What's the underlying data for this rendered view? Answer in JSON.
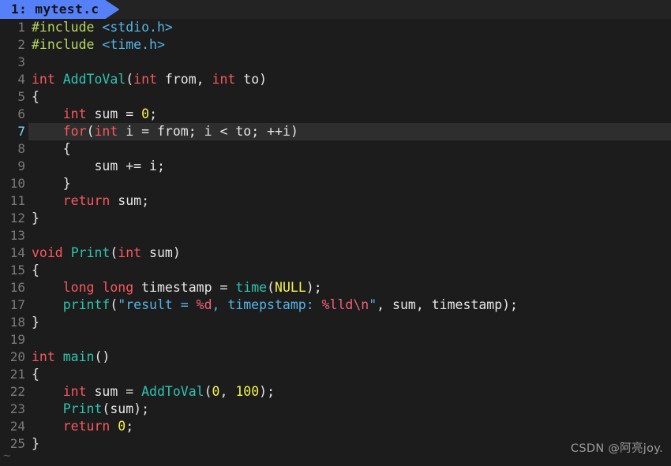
{
  "window": {
    "background_color": "#1c1c1c",
    "filler_marker": "~",
    "watermark": "CSDN @阿亮joy."
  },
  "tabbar": {
    "active_tab": {
      "label": "1: mytest.c",
      "number": "1",
      "filename": "mytest.c",
      "background_color": "#5580f7",
      "text_color": "#111111"
    }
  },
  "editor": {
    "cursor": {
      "line": 7,
      "character": "<",
      "color": "#16e316"
    },
    "current_line": 7,
    "line_count": 25,
    "lines": [
      {
        "n": "1",
        "text": "#include <stdio.h>"
      },
      {
        "n": "2",
        "text": "#include <time.h>"
      },
      {
        "n": "3",
        "text": ""
      },
      {
        "n": "4",
        "text": "int AddToVal(int from, int to)"
      },
      {
        "n": "5",
        "text": "{"
      },
      {
        "n": "6",
        "text": "    int sum = 0;"
      },
      {
        "n": "7",
        "text": "    for(int i = from; i < to; ++i)"
      },
      {
        "n": "8",
        "text": "    {"
      },
      {
        "n": "9",
        "text": "        sum += i;"
      },
      {
        "n": "10",
        "text": "    }"
      },
      {
        "n": "11",
        "text": "    return sum;"
      },
      {
        "n": "12",
        "text": "}"
      },
      {
        "n": "13",
        "text": ""
      },
      {
        "n": "14",
        "text": "void Print(int sum)"
      },
      {
        "n": "15",
        "text": "{"
      },
      {
        "n": "16",
        "text": "    long long timestamp = time(NULL);"
      },
      {
        "n": "17",
        "text": "    printf(\"result = %d, timepstamp: %lld\\n\", sum, timestamp);"
      },
      {
        "n": "18",
        "text": "}"
      },
      {
        "n": "19",
        "text": ""
      },
      {
        "n": "20",
        "text": "int main()"
      },
      {
        "n": "21",
        "text": "{"
      },
      {
        "n": "22",
        "text": "    int sum = AddToVal(0, 100);"
      },
      {
        "n": "23",
        "text": "    Print(sum);"
      },
      {
        "n": "24",
        "text": "    return 0;"
      },
      {
        "n": "25",
        "text": "}"
      }
    ]
  },
  "syntax_colors": {
    "preprocessor": "#b5d85e",
    "header": "#54b5e8",
    "keyword": "#f9585f",
    "function": "#2ec4b0",
    "number": "#f2f24a",
    "string": "#54b5e8",
    "format_specifier": "#f0617a",
    "plain": "#e6e6e6",
    "line_number": "#7b7b7b",
    "current_line_number": "#7fd4ff",
    "current_line_bg": "#2e2e2e"
  }
}
